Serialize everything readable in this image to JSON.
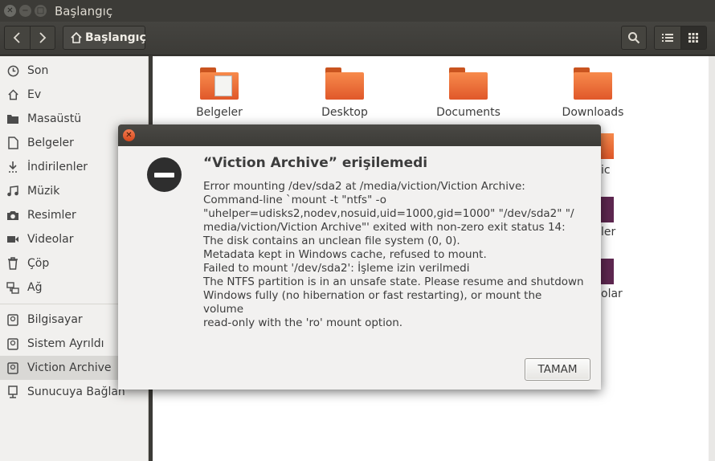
{
  "window": {
    "title": "Başlangıç"
  },
  "toolbar": {
    "breadcrumb": "Başlangıç"
  },
  "sidebar": {
    "items": [
      {
        "label": "Son",
        "icon": "clock-icon"
      },
      {
        "label": "Ev",
        "icon": "home-icon"
      },
      {
        "label": "Masaüstü",
        "icon": "folder-icon"
      },
      {
        "label": "Belgeler",
        "icon": "document-icon"
      },
      {
        "label": "İndirilenler",
        "icon": "download-icon"
      },
      {
        "label": "Müzik",
        "icon": "music-icon"
      },
      {
        "label": "Resimler",
        "icon": "camera-icon"
      },
      {
        "label": "Videolar",
        "icon": "video-icon"
      },
      {
        "label": "Çöp",
        "icon": "trash-icon"
      },
      {
        "label": "Ağ",
        "icon": "network-icon"
      },
      {
        "label": "Bilgisayar",
        "icon": "drive-icon"
      },
      {
        "label": "Sistem Ayrıldı",
        "icon": "drive-icon"
      },
      {
        "label": "Viction Archive",
        "icon": "drive-icon"
      },
      {
        "label": "Sunucuya Bağlan",
        "icon": "server-icon"
      }
    ]
  },
  "main": {
    "folders": [
      {
        "label": "Belgeler"
      },
      {
        "label": "Desktop"
      },
      {
        "label": "Documents"
      },
      {
        "label": "Downloads"
      }
    ],
    "partial_labels": [
      "ic",
      "ler",
      "olar"
    ]
  },
  "dialog": {
    "heading": "“Viction Archive” erişilemedi",
    "lines": [
      "Error mounting /dev/sda2 at /media/viction/Viction Archive:",
      "Command-line `mount -t \"ntfs\" -o",
      "\"uhelper=udisks2,nodev,nosuid,uid=1000,gid=1000\" \"/dev/sda2\" \"/",
      "media/viction/Viction Archive\"' exited with non-zero exit status 14:",
      "The disk contains an unclean file system (0, 0).",
      "Metadata kept in Windows cache, refused to mount.",
      "Failed to mount '/dev/sda2': İşleme izin verilmedi",
      "The NTFS partition is in an unsafe state. Please resume and shutdown",
      "Windows fully (no hibernation or fast restarting), or mount the",
      "volume",
      "read-only with the 'ro' mount option."
    ],
    "ok_label": "TAMAM"
  }
}
